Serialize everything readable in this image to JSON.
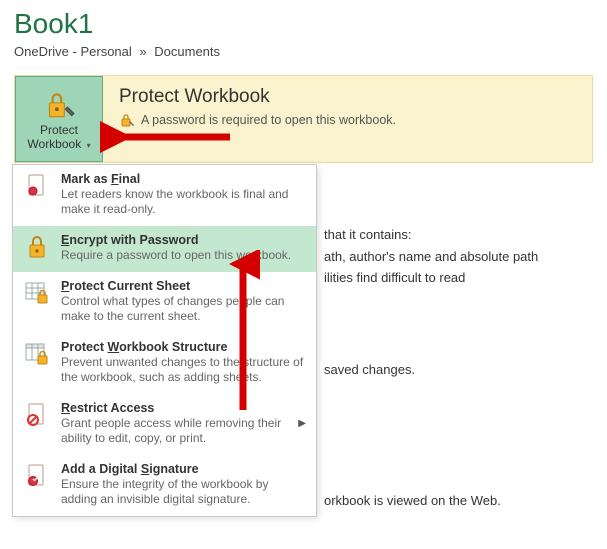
{
  "header": {
    "title": "Book1",
    "breadcrumb_loc": "OneDrive - Personal",
    "breadcrumb_sep": "»",
    "breadcrumb_folder": "Documents"
  },
  "banner": {
    "title": "Protect Workbook",
    "subtitle": "A password is required to open this workbook.",
    "button_line1": "Protect",
    "button_line2": "Workbook"
  },
  "menu": {
    "mark_final": {
      "title_pre": "Mark as ",
      "title_ul": "F",
      "title_post": "inal",
      "desc": "Let readers know the workbook is final and make it read-only."
    },
    "encrypt": {
      "title_pre": "",
      "title_ul": "E",
      "title_post": "ncrypt with Password",
      "desc": "Require a password to open this workbook."
    },
    "protect_sheet": {
      "title_pre": "",
      "title_ul": "P",
      "title_post": "rotect Current Sheet",
      "desc": "Control what types of changes people can make to the current sheet."
    },
    "protect_structure": {
      "title_pre": "Protect ",
      "title_ul": "W",
      "title_post": "orkbook Structure",
      "desc": "Prevent unwanted changes to the structure of the workbook, such as adding sheets."
    },
    "restrict": {
      "title_pre": "",
      "title_ul": "R",
      "title_post": "estrict Access",
      "desc": "Grant people access while removing their ability to edit, copy, or print."
    },
    "signature": {
      "title_pre": "Add a Digital ",
      "title_ul": "S",
      "title_post": "ignature",
      "desc": "Ensure the integrity of the workbook by adding an invisible digital signature."
    }
  },
  "background_fragments": {
    "f1": "that it contains:",
    "f2": "ath, author's name and absolute path",
    "f3": "ilities find difficult to read",
    "f4": "saved changes.",
    "f5": "orkbook is viewed on the Web."
  }
}
